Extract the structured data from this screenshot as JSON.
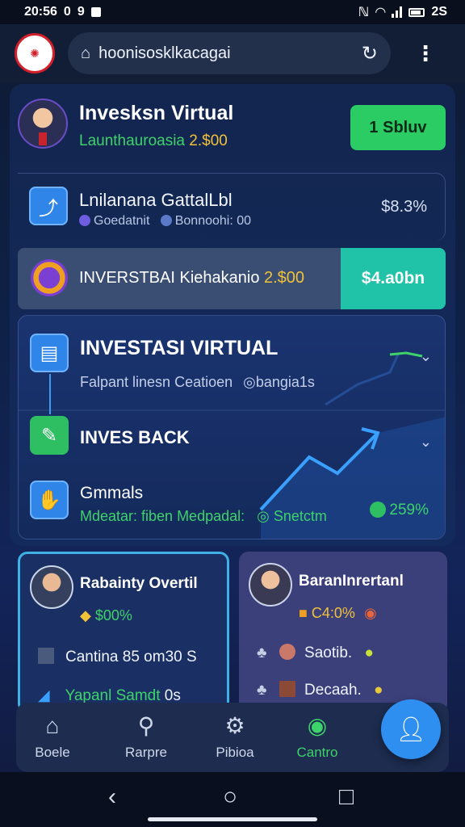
{
  "status_bar": {
    "time": "20:56",
    "left_icons": [
      "0",
      "9"
    ],
    "battery_text": "2S"
  },
  "browser": {
    "url": "hoonisosklkacagai"
  },
  "profile": {
    "title": "Invesksn Virtual",
    "subtitle_prefix": "Launthauroasia",
    "subtitle_amount": "2.$00",
    "button_label": "1 Sbluv"
  },
  "capital_card": {
    "title": "Lnilanana GattalLbl",
    "sub_left": "Goedatnit",
    "sub_right": "Bonnoohi: 00",
    "value": "$8.3%"
  },
  "banner": {
    "text_prefix": "INVERSTBAI Kiehakanio",
    "text_amount": "2.$00",
    "button_label": "$4.a0bn"
  },
  "investment": {
    "title": "INVESTASI VIRTUAL",
    "subtitle": "Falpant linesn  Ceatioen",
    "subtitle_tag": "bangia1s",
    "back_label": "INVES BACK",
    "returns_title": "Gmmals",
    "returns_sub_left": "Mdeatar: fiben  Medpadal:",
    "returns_sub_right": "Snetctm",
    "returns_pct": "259%"
  },
  "card_left": {
    "title": "Rabainty Overtil",
    "value": "$00%",
    "row1": "Cantina 85 om30 S",
    "row2_label": "Yapanl Samdt",
    "row2_value": "0s"
  },
  "card_right": {
    "title": "BaranInrertanl",
    "value": "C4:0%",
    "row1": "Saotib.",
    "row2": "Decaah."
  },
  "nav": {
    "items": [
      {
        "label": "Boele",
        "icon": "home-icon"
      },
      {
        "label": "Rarpre",
        "icon": "search-icon"
      },
      {
        "label": "Pibioa",
        "icon": "gear-icon"
      },
      {
        "label": "Cantro",
        "icon": "user-icon"
      }
    ]
  },
  "colors": {
    "accent_green": "#3ed26a",
    "accent_blue": "#2f8ff0",
    "teal": "#20c3a7",
    "gold": "#f0c23a"
  }
}
